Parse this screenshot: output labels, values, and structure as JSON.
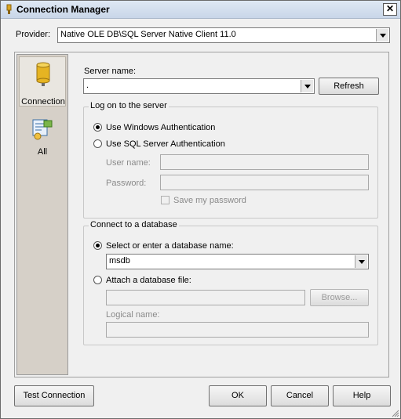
{
  "window": {
    "title": "Connection Manager",
    "close_glyph": "✕"
  },
  "provider": {
    "label": "Provider:",
    "value": "Native OLE DB\\SQL Server Native Client 11.0"
  },
  "nav": {
    "items": [
      {
        "label": "Connection",
        "icon": "database-cylinder-icon",
        "selected": true
      },
      {
        "label": "All",
        "icon": "properties-icon",
        "selected": false
      }
    ]
  },
  "server": {
    "label": "Server name:",
    "value": ".",
    "refresh_label": "Refresh"
  },
  "logon": {
    "group_title": "Log on to the server",
    "windows_auth_label": "Use Windows Authentication",
    "sql_auth_label": "Use SQL Server Authentication",
    "username_label": "User name:",
    "password_label": "Password:",
    "save_password_label": "Save my password",
    "windows_auth_selected": true
  },
  "database": {
    "group_title": "Connect to a database",
    "select_label": "Select or enter a database name:",
    "select_value": "msdb",
    "attach_label": "Attach a database file:",
    "browse_label": "Browse...",
    "logical_name_label": "Logical name:",
    "select_selected": true
  },
  "footer": {
    "test_label": "Test Connection",
    "ok_label": "OK",
    "cancel_label": "Cancel",
    "help_label": "Help"
  }
}
